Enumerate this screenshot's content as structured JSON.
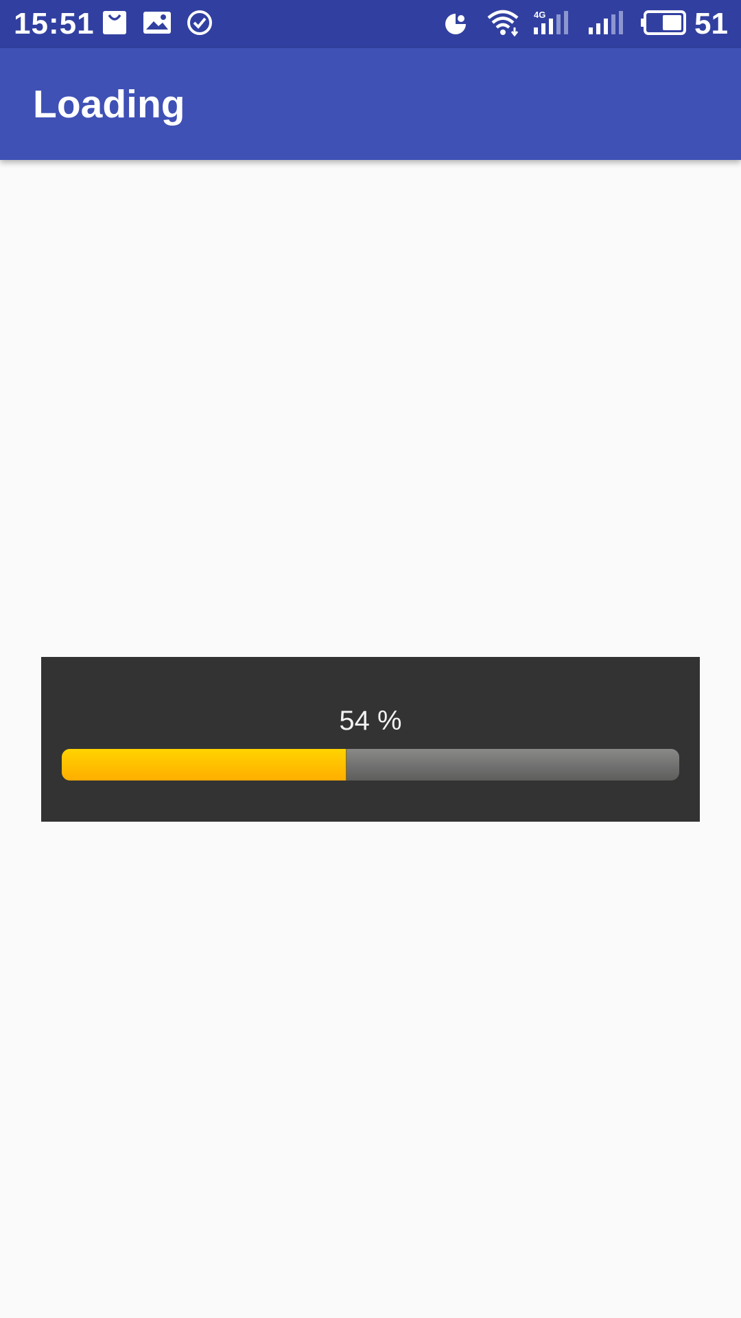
{
  "status_bar": {
    "time": "15:51",
    "battery_level": "51",
    "network_type": "4G",
    "icons": [
      "shopping-bag-icon",
      "image-icon",
      "check-circle-icon",
      "data-saver-icon",
      "wifi-icon",
      "cellular-signal-4g-icon",
      "cellular-signal-icon",
      "battery-icon"
    ]
  },
  "app_bar": {
    "title": "Loading",
    "color": "#3f51b5"
  },
  "progress_dialog": {
    "percent_label": "54 %",
    "progress": 0.46,
    "fill_color": "#ffbf00",
    "track_color": "#707070",
    "background_color": "#333333"
  }
}
